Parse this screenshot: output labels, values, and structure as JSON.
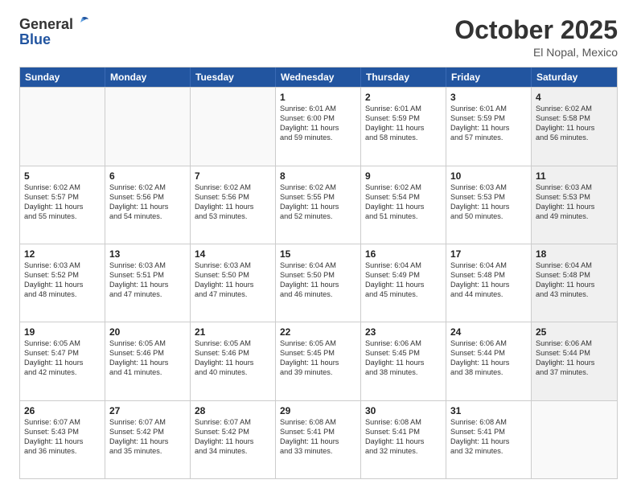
{
  "header": {
    "logo_line1": "General",
    "logo_line2": "Blue",
    "month": "October 2025",
    "location": "El Nopal, Mexico"
  },
  "weekdays": [
    "Sunday",
    "Monday",
    "Tuesday",
    "Wednesday",
    "Thursday",
    "Friday",
    "Saturday"
  ],
  "weeks": [
    [
      {
        "day": "",
        "text": "",
        "empty": true
      },
      {
        "day": "",
        "text": "",
        "empty": true
      },
      {
        "day": "",
        "text": "",
        "empty": true
      },
      {
        "day": "1",
        "text": "Sunrise: 6:01 AM\nSunset: 6:00 PM\nDaylight: 11 hours\nand 59 minutes."
      },
      {
        "day": "2",
        "text": "Sunrise: 6:01 AM\nSunset: 5:59 PM\nDaylight: 11 hours\nand 58 minutes."
      },
      {
        "day": "3",
        "text": "Sunrise: 6:01 AM\nSunset: 5:59 PM\nDaylight: 11 hours\nand 57 minutes."
      },
      {
        "day": "4",
        "text": "Sunrise: 6:02 AM\nSunset: 5:58 PM\nDaylight: 11 hours\nand 56 minutes.",
        "shaded": true
      }
    ],
    [
      {
        "day": "5",
        "text": "Sunrise: 6:02 AM\nSunset: 5:57 PM\nDaylight: 11 hours\nand 55 minutes."
      },
      {
        "day": "6",
        "text": "Sunrise: 6:02 AM\nSunset: 5:56 PM\nDaylight: 11 hours\nand 54 minutes."
      },
      {
        "day": "7",
        "text": "Sunrise: 6:02 AM\nSunset: 5:56 PM\nDaylight: 11 hours\nand 53 minutes."
      },
      {
        "day": "8",
        "text": "Sunrise: 6:02 AM\nSunset: 5:55 PM\nDaylight: 11 hours\nand 52 minutes."
      },
      {
        "day": "9",
        "text": "Sunrise: 6:02 AM\nSunset: 5:54 PM\nDaylight: 11 hours\nand 51 minutes."
      },
      {
        "day": "10",
        "text": "Sunrise: 6:03 AM\nSunset: 5:53 PM\nDaylight: 11 hours\nand 50 minutes."
      },
      {
        "day": "11",
        "text": "Sunrise: 6:03 AM\nSunset: 5:53 PM\nDaylight: 11 hours\nand 49 minutes.",
        "shaded": true
      }
    ],
    [
      {
        "day": "12",
        "text": "Sunrise: 6:03 AM\nSunset: 5:52 PM\nDaylight: 11 hours\nand 48 minutes."
      },
      {
        "day": "13",
        "text": "Sunrise: 6:03 AM\nSunset: 5:51 PM\nDaylight: 11 hours\nand 47 minutes."
      },
      {
        "day": "14",
        "text": "Sunrise: 6:03 AM\nSunset: 5:50 PM\nDaylight: 11 hours\nand 47 minutes."
      },
      {
        "day": "15",
        "text": "Sunrise: 6:04 AM\nSunset: 5:50 PM\nDaylight: 11 hours\nand 46 minutes."
      },
      {
        "day": "16",
        "text": "Sunrise: 6:04 AM\nSunset: 5:49 PM\nDaylight: 11 hours\nand 45 minutes."
      },
      {
        "day": "17",
        "text": "Sunrise: 6:04 AM\nSunset: 5:48 PM\nDaylight: 11 hours\nand 44 minutes."
      },
      {
        "day": "18",
        "text": "Sunrise: 6:04 AM\nSunset: 5:48 PM\nDaylight: 11 hours\nand 43 minutes.",
        "shaded": true
      }
    ],
    [
      {
        "day": "19",
        "text": "Sunrise: 6:05 AM\nSunset: 5:47 PM\nDaylight: 11 hours\nand 42 minutes."
      },
      {
        "day": "20",
        "text": "Sunrise: 6:05 AM\nSunset: 5:46 PM\nDaylight: 11 hours\nand 41 minutes."
      },
      {
        "day": "21",
        "text": "Sunrise: 6:05 AM\nSunset: 5:46 PM\nDaylight: 11 hours\nand 40 minutes."
      },
      {
        "day": "22",
        "text": "Sunrise: 6:05 AM\nSunset: 5:45 PM\nDaylight: 11 hours\nand 39 minutes."
      },
      {
        "day": "23",
        "text": "Sunrise: 6:06 AM\nSunset: 5:45 PM\nDaylight: 11 hours\nand 38 minutes."
      },
      {
        "day": "24",
        "text": "Sunrise: 6:06 AM\nSunset: 5:44 PM\nDaylight: 11 hours\nand 38 minutes."
      },
      {
        "day": "25",
        "text": "Sunrise: 6:06 AM\nSunset: 5:44 PM\nDaylight: 11 hours\nand 37 minutes.",
        "shaded": true
      }
    ],
    [
      {
        "day": "26",
        "text": "Sunrise: 6:07 AM\nSunset: 5:43 PM\nDaylight: 11 hours\nand 36 minutes."
      },
      {
        "day": "27",
        "text": "Sunrise: 6:07 AM\nSunset: 5:42 PM\nDaylight: 11 hours\nand 35 minutes."
      },
      {
        "day": "28",
        "text": "Sunrise: 6:07 AM\nSunset: 5:42 PM\nDaylight: 11 hours\nand 34 minutes."
      },
      {
        "day": "29",
        "text": "Sunrise: 6:08 AM\nSunset: 5:41 PM\nDaylight: 11 hours\nand 33 minutes."
      },
      {
        "day": "30",
        "text": "Sunrise: 6:08 AM\nSunset: 5:41 PM\nDaylight: 11 hours\nand 32 minutes."
      },
      {
        "day": "31",
        "text": "Sunrise: 6:08 AM\nSunset: 5:41 PM\nDaylight: 11 hours\nand 32 minutes."
      },
      {
        "day": "",
        "text": "",
        "empty": true,
        "shaded": true
      }
    ]
  ]
}
